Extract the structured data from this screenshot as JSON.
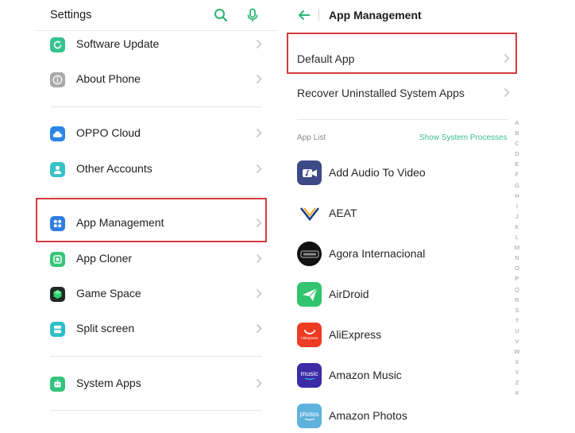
{
  "settings": {
    "title": "Settings",
    "items": [
      {
        "label": "Software Update",
        "icon": "refresh-icon",
        "color": "#34c38f"
      },
      {
        "label": "About Phone",
        "icon": "info-icon",
        "color": "#a9a9a9"
      },
      {
        "label": "OPPO Cloud",
        "icon": "cloud-icon",
        "color": "#2a86e6"
      },
      {
        "label": "Other Accounts",
        "icon": "person-icon",
        "color": "#39c1c8"
      },
      {
        "label": "App Management",
        "icon": "apps-grid-icon",
        "color": "#2f7de0"
      },
      {
        "label": "App Cloner",
        "icon": "cloner-icon",
        "color": "#37c37a"
      },
      {
        "label": "Game Space",
        "icon": "cube-icon",
        "color": "#1f2a25"
      },
      {
        "label": "Split screen",
        "icon": "split-screen-icon",
        "color": "#30bfc9"
      },
      {
        "label": "System Apps",
        "icon": "robot-icon",
        "color": "#33c47f"
      }
    ]
  },
  "app_management": {
    "title": "App Management",
    "default_app": "Default App",
    "recover": "Recover Uninstalled System Apps",
    "app_list_label": "App List",
    "show_system_processes": "Show System Processes",
    "apps": [
      {
        "name": "Add Audio To Video",
        "icon": "video-audio-icon",
        "color": "#3c4a86"
      },
      {
        "name": "AEAT",
        "icon": "aeat-logo-icon",
        "color": "#ffffff"
      },
      {
        "name": "Agora Internacional",
        "icon": "agora-logo-icon",
        "color": "#111111"
      },
      {
        "name": "AirDroid",
        "icon": "airdroid-icon",
        "color": "#32c46e"
      },
      {
        "name": "AliExpress",
        "icon": "aliexpress-icon",
        "color": "#ee3c24"
      },
      {
        "name": "Amazon Music",
        "icon": "amazon-music-icon",
        "color": "#3b2ba6"
      },
      {
        "name": "Amazon Photos",
        "icon": "amazon-photos-icon",
        "color": "#5fb2dc"
      }
    ],
    "icon_texts": {
      "aliexpress": "AliExpress",
      "music": "music",
      "photos": "photos"
    },
    "alphabet": [
      "A",
      "B",
      "C",
      "D",
      "E",
      "F",
      "G",
      "H",
      "I",
      "J",
      "K",
      "L",
      "M",
      "N",
      "O",
      "P",
      "Q",
      "R",
      "S",
      "T",
      "U",
      "V",
      "W",
      "X",
      "Y",
      "Z",
      "#"
    ]
  },
  "colors": {
    "accent": "#2bb673",
    "highlight": "#d33b3b"
  }
}
